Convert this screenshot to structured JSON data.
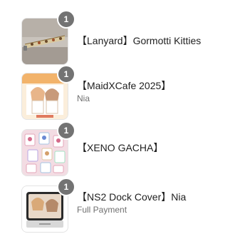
{
  "cart": {
    "items": [
      {
        "title": "【Lanyard】Gormotti Kitties",
        "subtitle": "",
        "quantity": "1",
        "image_icon": "lanyard-product-image"
      },
      {
        "title": "【MaidXCafe 2025】",
        "subtitle": "Nia",
        "quantity": "1",
        "image_icon": "maid-cafe-product-image"
      },
      {
        "title": "【XENO GACHA】",
        "subtitle": "",
        "quantity": "1",
        "image_icon": "gacha-product-image"
      },
      {
        "title": "【NS2 Dock Cover】Nia",
        "subtitle": "Full Payment",
        "quantity": "1",
        "image_icon": "dock-cover-product-image"
      }
    ]
  },
  "colors": {
    "badge": "#737373",
    "title_text": "#1f1f1f",
    "subtitle_text": "#707070"
  }
}
